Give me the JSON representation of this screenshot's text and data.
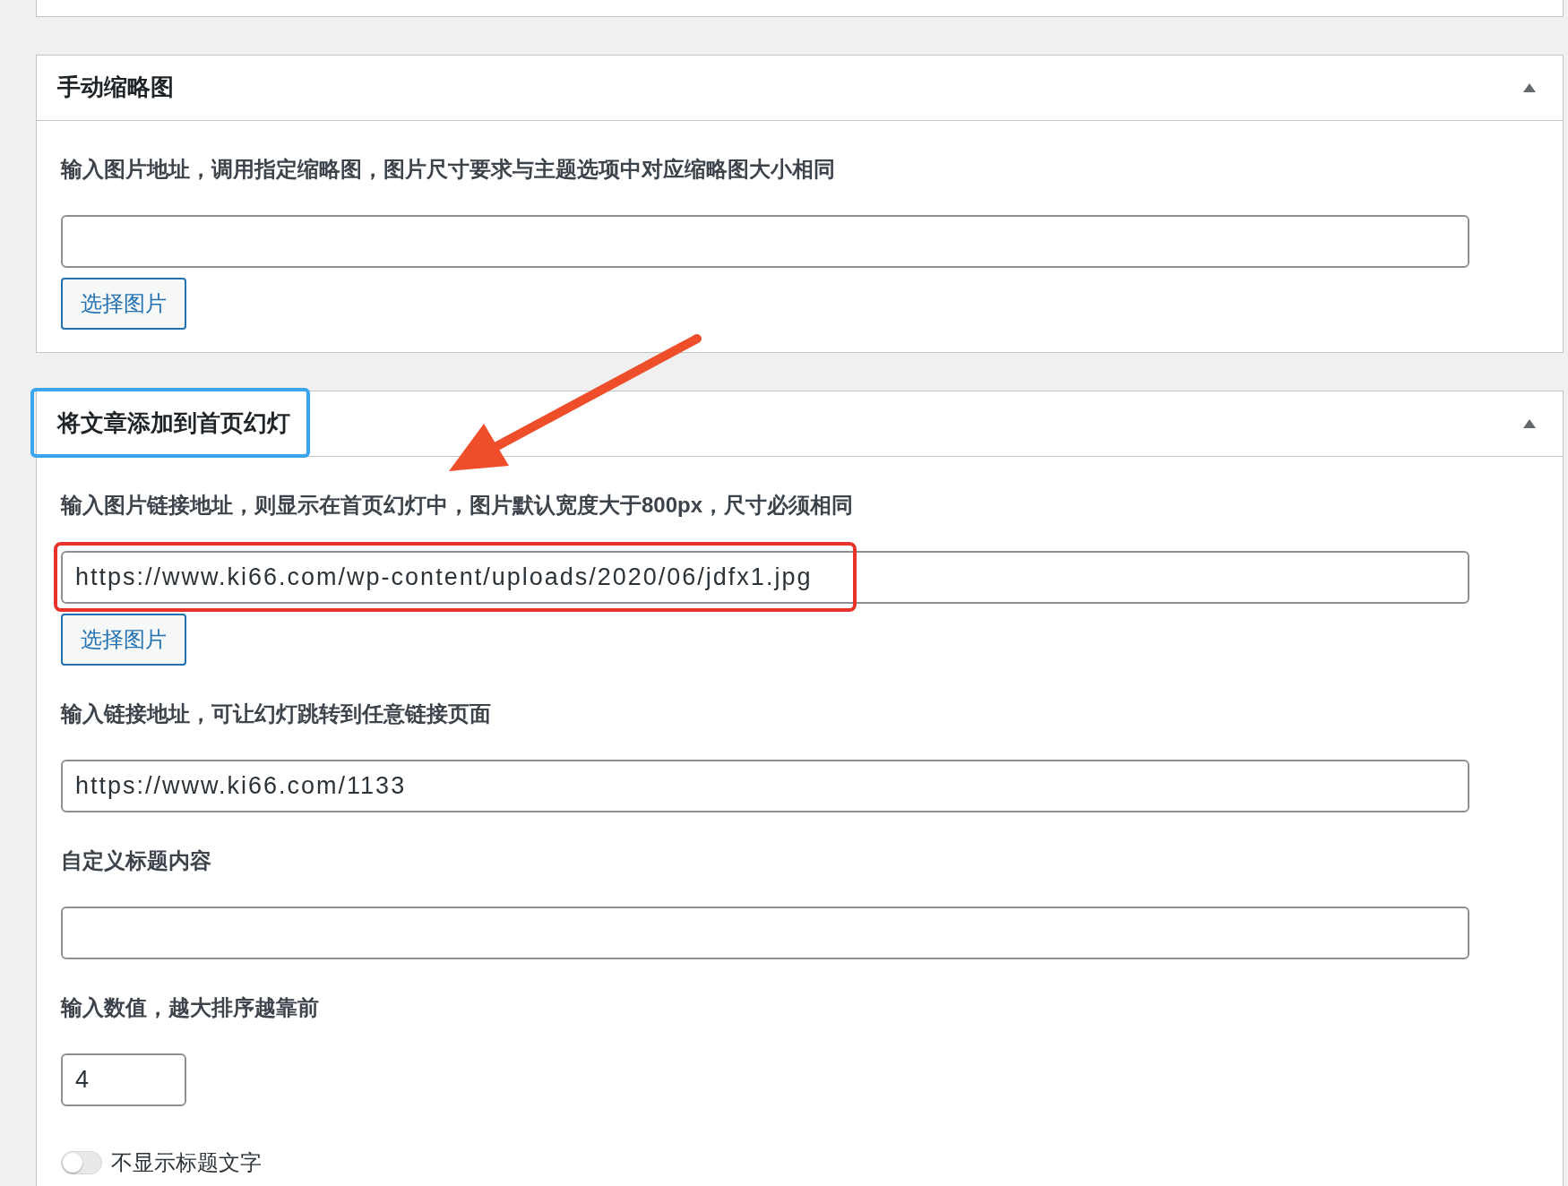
{
  "panels": [
    {
      "title": "手动缩略图",
      "title_highlighted": false,
      "expanded": true,
      "fields": [
        {
          "kind": "image",
          "label": "输入图片地址，调用指定缩略图，图片尺寸要求与主题选项中对应缩略图大小相同",
          "button": "选择图片"
        }
      ]
    },
    {
      "title": "将文章添加到首页幻灯",
      "title_highlighted": true,
      "expanded": true,
      "pointer_arrow": true,
      "fields": [
        {
          "kind": "image",
          "label": "输入图片链接地址，则显示在首页幻灯中，图片默认宽度大于800px，尺寸必须相同",
          "value": "https://www.ki66.com/wp-content/uploads/2020/06/jdfx1.jpg",
          "button": "选择图片",
          "highlighted": true
        },
        {
          "kind": "text",
          "label": "输入链接地址，可让幻灯跳转到任意链接页面",
          "value": "https://www.ki66.com/1133"
        },
        {
          "kind": "text",
          "label": "自定义标题内容"
        },
        {
          "kind": "number",
          "label": "输入数值，越大排序越靠前",
          "value": "4"
        },
        {
          "kind": "toggle",
          "label": "不显示标题文字",
          "on": false
        }
      ]
    }
  ]
}
